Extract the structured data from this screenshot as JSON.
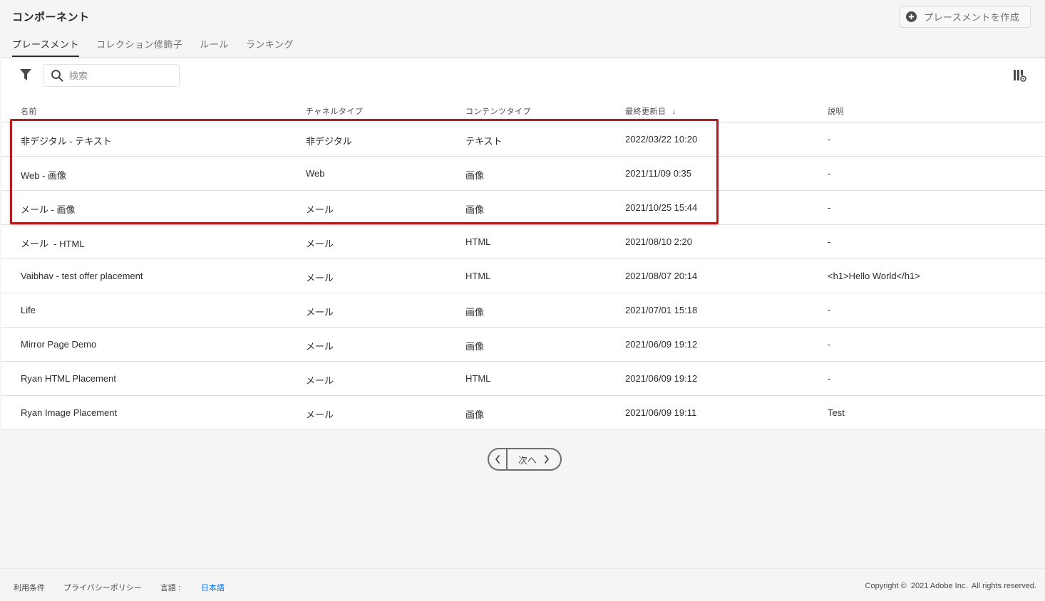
{
  "header": {
    "title": "コンポーネント",
    "create_button_label": "プレースメントを作成"
  },
  "tabs": [
    {
      "label": "プレースメント",
      "active": true
    },
    {
      "label": "コレクション修飾子",
      "active": false
    },
    {
      "label": "ルール",
      "active": false
    },
    {
      "label": "ランキング",
      "active": false
    }
  ],
  "toolbar": {
    "search_placeholder": "検索",
    "search_value": ""
  },
  "table": {
    "columns": [
      "名前",
      "チャネルタイプ",
      "コンテンツタイプ",
      "最終更新日",
      "説明"
    ],
    "sorted_column": "最終更新日",
    "sort_direction": "descending",
    "rows": [
      {
        "name": "非デジタル - テキスト",
        "channel": "非デジタル",
        "content": "テキスト",
        "modified": "2022/03/22 10:20",
        "description": "-"
      },
      {
        "name": "Web - 画像",
        "channel": "Web",
        "content": "画像",
        "modified": "2021/11/09 0:35",
        "description": "-"
      },
      {
        "name": "メール - 画像",
        "channel": "メール",
        "content": "画像",
        "modified": "2021/10/25 15:44",
        "description": "-"
      },
      {
        "name": "メール  - HTML",
        "channel": "メール",
        "content": "HTML",
        "modified": "2021/08/10 2:20",
        "description": "-"
      },
      {
        "name": "Vaibhav - test offer placement",
        "channel": "メール",
        "content": "HTML",
        "modified": "2021/08/07 20:14",
        "description": "<h1>Hello World</h1>"
      },
      {
        "name": "Life",
        "channel": "メール",
        "content": "画像",
        "modified": "2021/07/01 15:18",
        "description": "-"
      },
      {
        "name": "Mirror Page Demo",
        "channel": "メール",
        "content": "画像",
        "modified": "2021/06/09 19:12",
        "description": "-"
      },
      {
        "name": "Ryan HTML Placement",
        "channel": "メール",
        "content": "HTML",
        "modified": "2021/06/09 19:12",
        "description": "-"
      },
      {
        "name": "Ryan Image Placement",
        "channel": "メール",
        "content": "画像",
        "modified": "2021/06/09 19:11",
        "description": "Test"
      }
    ]
  },
  "pagination": {
    "next_label": "次へ"
  },
  "footer": {
    "terms": "利用条件",
    "privacy": "プライバシーポリシー",
    "language_label": "言語 : ",
    "language_value": "日本語",
    "copyright": "Copyright ©  2021 Adobe Inc.  All rights reserved."
  },
  "icons": {
    "create": "plus-circle-icon",
    "filter": "filter-icon",
    "search": "search-icon",
    "column_settings": "column-settings-icon",
    "sort": "arrow-down-icon",
    "prev": "chevron-left-icon",
    "next": "chevron-right-icon"
  },
  "colors": {
    "highlight": "#b01e22",
    "link": "#1473e6"
  }
}
